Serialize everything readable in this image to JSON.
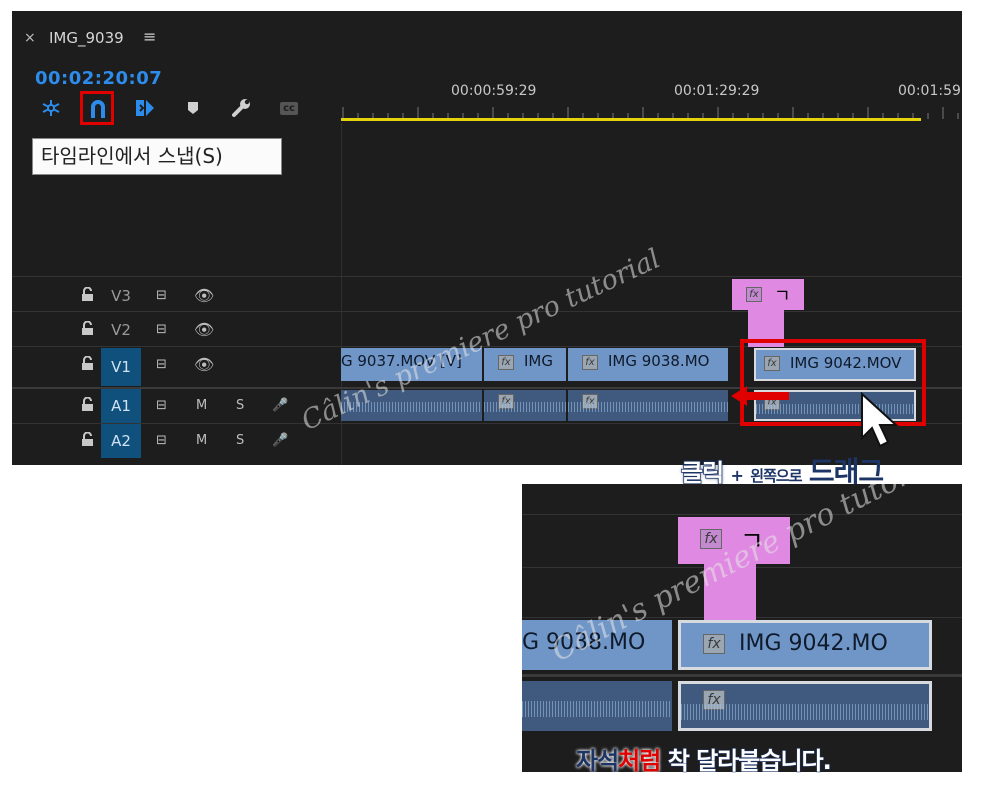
{
  "panel": {
    "tab": {
      "close": "×",
      "title": "IMG_9039",
      "menu": "≡"
    },
    "timecode": "00:02:20:07",
    "tools": [
      {
        "name": "nest-icon"
      },
      {
        "name": "snap-magnet-icon"
      },
      {
        "name": "linked-selection-icon"
      },
      {
        "name": "add-marker-icon"
      },
      {
        "name": "wrench-icon"
      },
      {
        "name": "captions-icon",
        "label": "cc"
      }
    ],
    "tooltip": "타임라인에서 스냅(S)",
    "ruler_labels": [
      "00:00:59:29",
      "00:01:29:29",
      "00:01:59"
    ],
    "tracks": [
      {
        "name": "V3",
        "type": "video"
      },
      {
        "name": "V2",
        "type": "video"
      },
      {
        "name": "V1",
        "type": "video"
      },
      {
        "name": "A1",
        "type": "audio",
        "m": "M",
        "s": "S"
      },
      {
        "name": "A2",
        "type": "audio",
        "m": "M",
        "s": "S"
      }
    ],
    "clips": {
      "c1": "G  9037.MOV [V]",
      "c2": "IMG",
      "c3": "IMG  9038.MO",
      "c4": "IMG  9042.MOV",
      "fx": "fx",
      "pink_label": "ㄱ"
    }
  },
  "watermark": "Câlin's premiere pro tutorial",
  "caption_top": {
    "part1": "클릭",
    "plus": "+",
    "part2": "왼쪽으로",
    "part3": "드래그"
  },
  "zoom": {
    "clip_left": "G  9038.MO",
    "clip_right": "IMG  9042.MO",
    "fx": "fx",
    "pink_label": "ㄱ"
  },
  "caption_bottom": {
    "part1": "자석",
    "part2": "처럼",
    "part3": "착 달라붙습니다."
  },
  "colors": {
    "timecode": "#2d8ceb",
    "highlight": "#e00000",
    "clip": "#7096c8",
    "pink": "#e089e2",
    "track_active": "#10507d"
  }
}
